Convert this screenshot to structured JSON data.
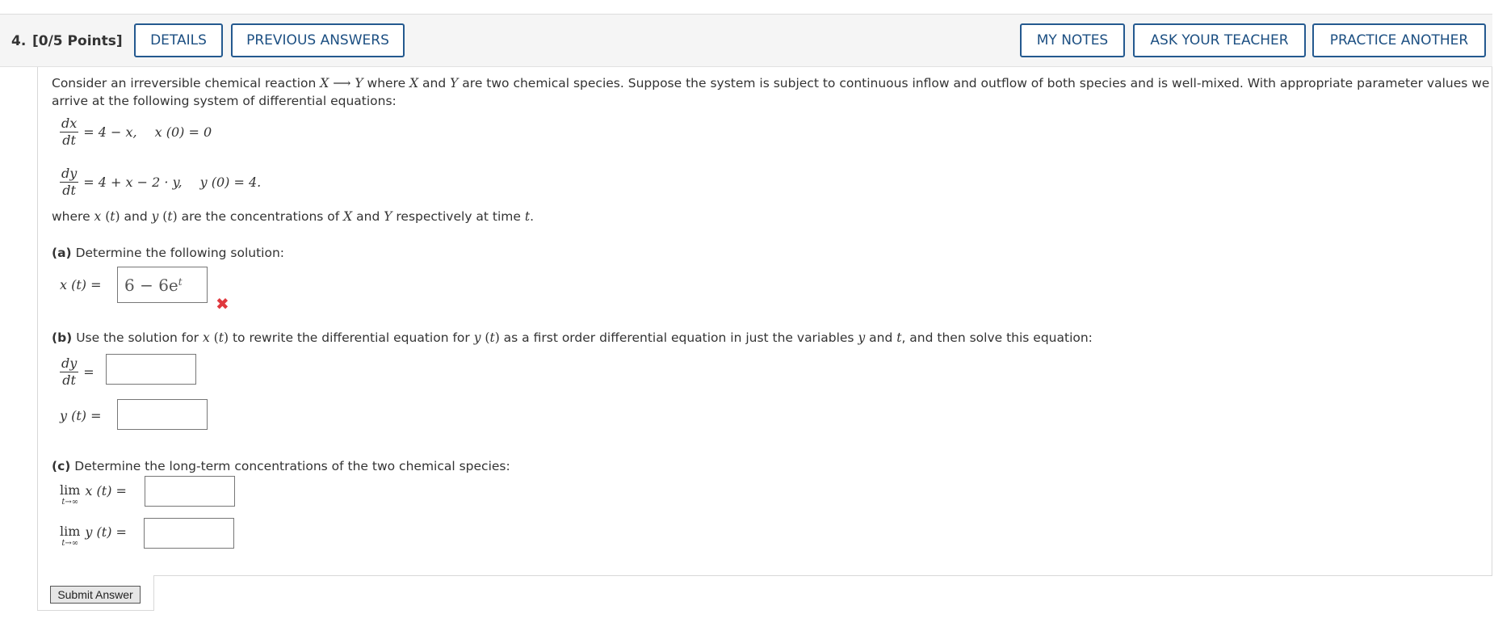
{
  "question": {
    "number": "4.",
    "points": "[0/5 Points]"
  },
  "toolbar": {
    "details_label": "DETAILS",
    "previous_answers_label": "PREVIOUS ANSWERS",
    "my_notes_label": "MY NOTES",
    "ask_teacher_label": "ASK YOUR TEACHER",
    "practice_another_label": "PRACTICE ANOTHER"
  },
  "intro": {
    "line1_a": "Consider an irreversible chemical reaction ",
    "line1_b": " where ",
    "line1_c": " and ",
    "line1_d": " are two chemical species. Suppose the system is subject to continuous inflow and outflow of both species and is well-mixed. With appropriate parameter values we can",
    "line2": "arrive at the following system of differential equations:"
  },
  "equations": {
    "eq1_rhs": "= 4 − x,",
    "eq1_ic": "x (0) = 0",
    "eq2_rhs": "= 4 + x − 2 · y,",
    "eq2_ic": "y (0) = 4."
  },
  "where_text": {
    "a": "where ",
    "b": " and ",
    "c": " are the concentrations of ",
    "d": " and ",
    "e": " respectively at time ",
    "f": "."
  },
  "part_a": {
    "label": "(a)",
    "text": " Determine the following solution:",
    "lhs": "x (t) =",
    "answer_base": "6 − 6e",
    "answer_exp": "t",
    "status": "incorrect"
  },
  "part_b": {
    "label": "(b)",
    "text_a": " Use the solution for ",
    "text_b": " to rewrite the differential equation for ",
    "text_c": " as a first order differential equation in just the variables ",
    "text_d": " and ",
    "text_e": ", and then solve this equation:",
    "dy_dt_answer": "",
    "y_lhs": "y (t) =",
    "y_answer": ""
  },
  "part_c": {
    "label": "(c)",
    "text": " Determine the long-term concentrations of the two chemical species:",
    "lim_word": "lim",
    "lim_sub": "t→∞",
    "x_lhs": "x (t) =",
    "y_lhs": "y (t) =",
    "x_answer": "",
    "y_answer": ""
  },
  "submit_label": "Submit Answer",
  "colors": {
    "accent": "#24598f",
    "error": "#e0383e"
  },
  "icons": {
    "incorrect": "x-mark-icon"
  }
}
